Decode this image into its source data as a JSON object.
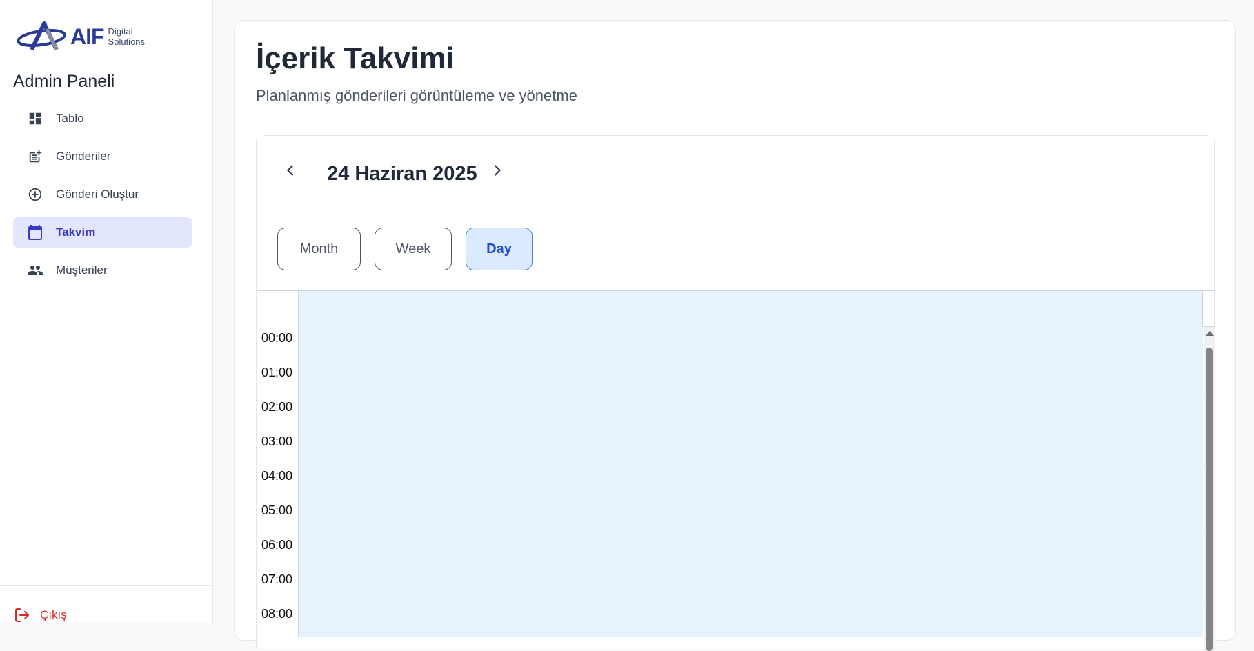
{
  "brand": {
    "name": "AIF",
    "sub_line1": "Digital",
    "sub_line2": "Solutions"
  },
  "sidebar": {
    "title": "Admin Paneli",
    "items": [
      {
        "label": "Tablo",
        "icon": "dashboard-icon",
        "active": false
      },
      {
        "label": "Gönderiler",
        "icon": "post-add-icon",
        "active": false
      },
      {
        "label": "Gönderi Oluştur",
        "icon": "add-circle-icon",
        "active": false
      },
      {
        "label": "Takvim",
        "icon": "calendar-icon",
        "active": true
      },
      {
        "label": "Müşteriler",
        "icon": "people-icon",
        "active": false
      }
    ],
    "logout_label": "Çıkış"
  },
  "page": {
    "title": "İçerik Takvimi",
    "subtitle": "Planlanmış gönderileri görüntüleme ve yönetme"
  },
  "calendar": {
    "current_date": "24 Haziran 2025",
    "views": [
      "Month",
      "Week",
      "Day"
    ],
    "active_view": "Day",
    "hours": [
      "00:00",
      "01:00",
      "02:00",
      "03:00",
      "04:00",
      "05:00",
      "06:00",
      "07:00",
      "08:00"
    ]
  },
  "colors": {
    "accent": "#3b37c9",
    "active_nav_bg": "#e3e7fd",
    "day_bg": "#e6f3fd",
    "logout": "#dc2626",
    "active_view_bg": "#dbeafe"
  }
}
